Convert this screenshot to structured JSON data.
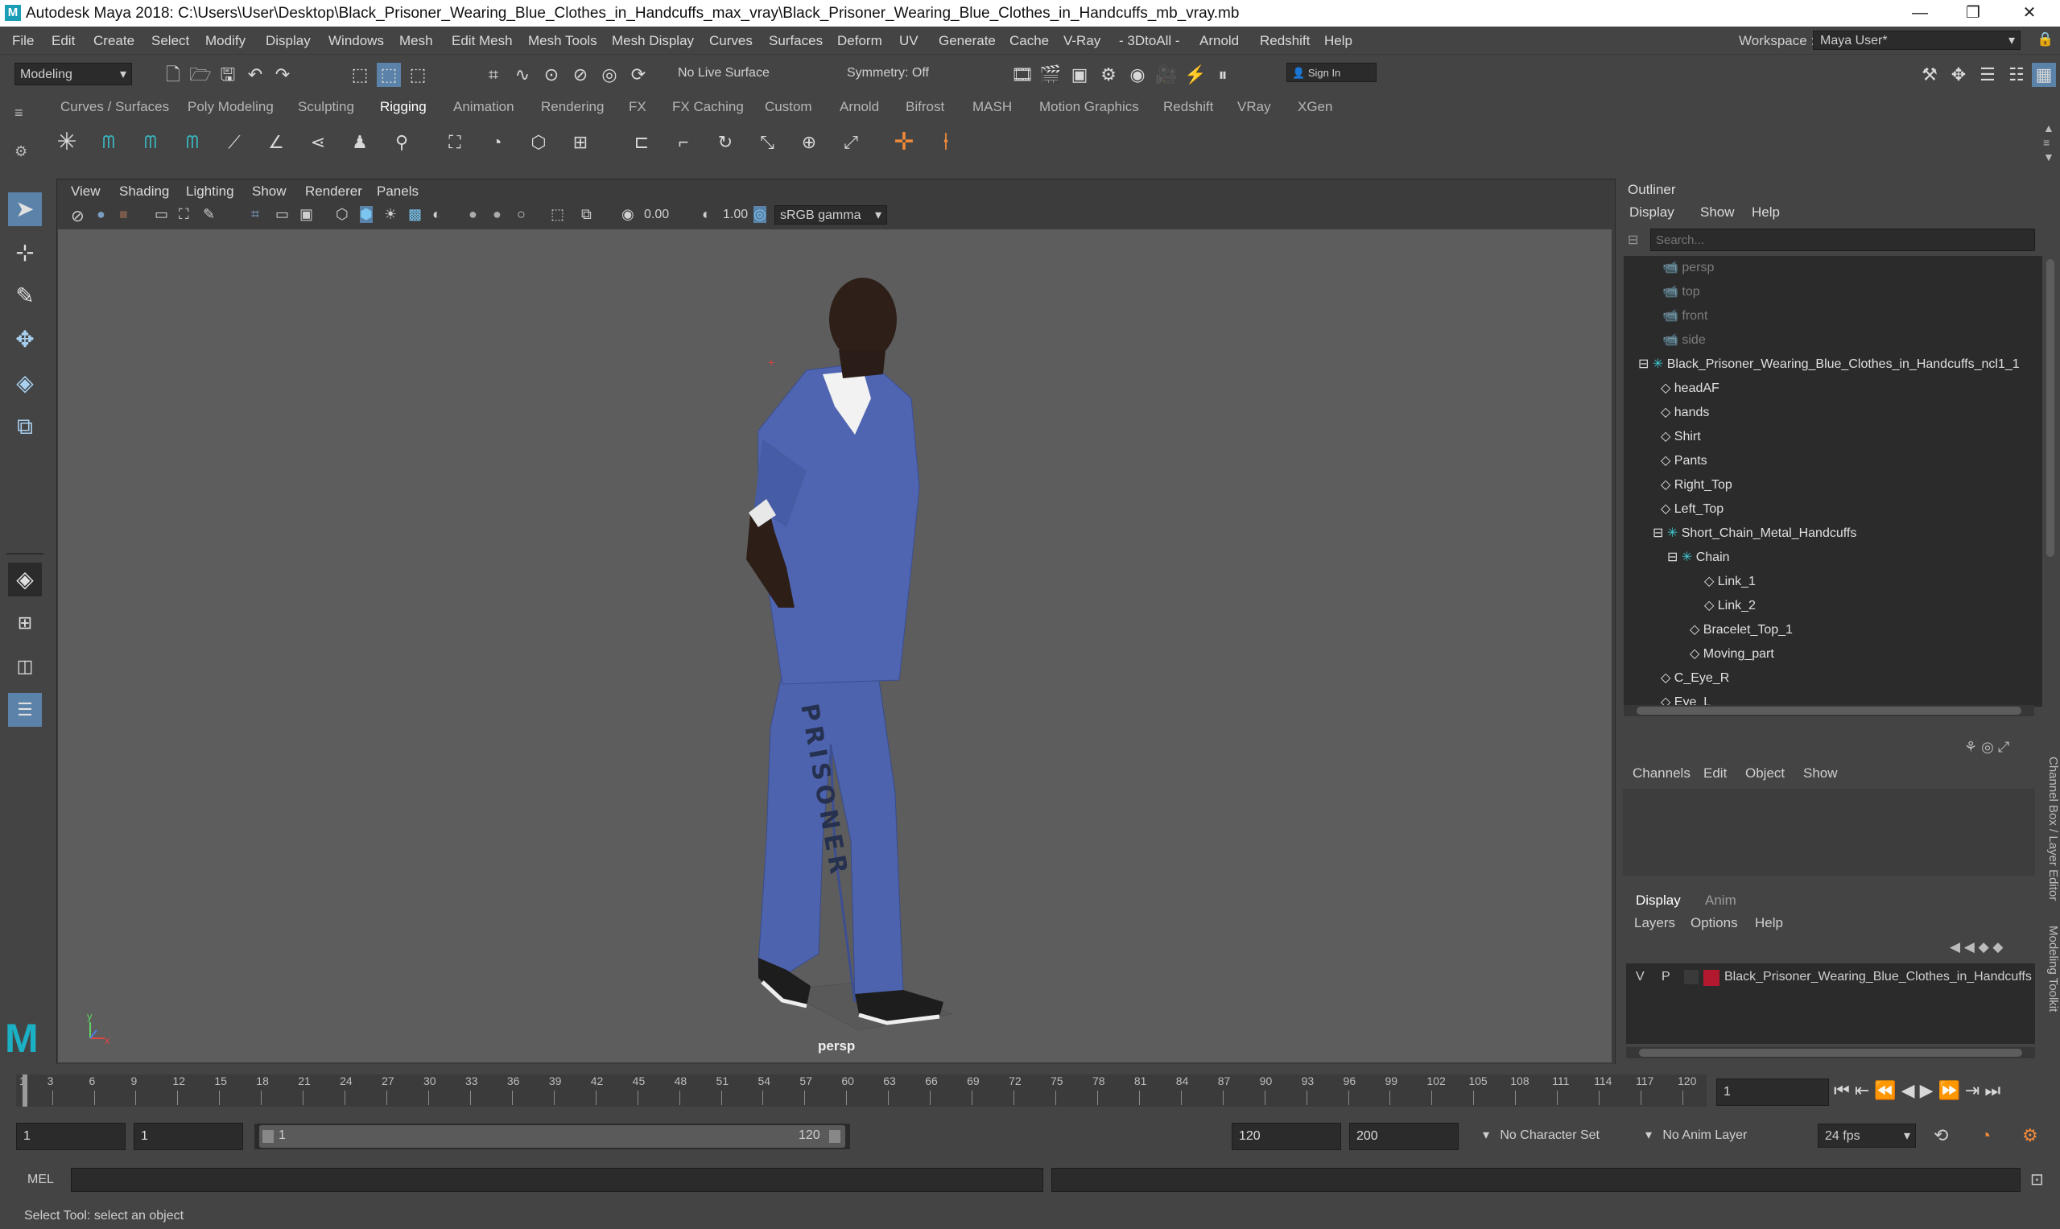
{
  "window": {
    "title": "Autodesk Maya 2018: C:\\Users\\User\\Desktop\\Black_Prisoner_Wearing_Blue_Clothes_in_Handcuffs_max_vray\\Black_Prisoner_Wearing_Blue_Clothes_in_Handcuffs_mb_vray.mb",
    "logo": "M",
    "controls": [
      "—",
      "❐",
      "✕"
    ]
  },
  "menubar": {
    "items": [
      "File",
      "Edit",
      "Create",
      "Select",
      "Modify",
      "Display",
      "Windows",
      "Mesh",
      "Edit Mesh",
      "Mesh Tools",
      "Mesh Display",
      "Curves",
      "Surfaces",
      "Deform",
      "UV",
      "Generate",
      "Cache",
      "V-Ray",
      "- 3DtoAll -",
      "Arnold",
      "Redshift",
      "Help"
    ],
    "workspace_label": "Workspace :",
    "workspace_value": "Maya User*"
  },
  "statusline": {
    "mode": "Modeling",
    "live_surface": "No Live Surface",
    "symmetry": "Symmetry: Off",
    "sign_in": "Sign In"
  },
  "shelf": {
    "tabs": [
      "Curves / Surfaces",
      "Poly Modeling",
      "Sculpting",
      "Rigging",
      "Animation",
      "Rendering",
      "FX",
      "FX Caching",
      "Custom",
      "Arnold",
      "Bifrost",
      "MASH",
      "Motion Graphics",
      "Redshift",
      "VRay",
      "XGen"
    ],
    "active_tab": "Rigging"
  },
  "viewport": {
    "menu": [
      "View",
      "Shading",
      "Lighting",
      "Show",
      "Renderer",
      "Panels"
    ],
    "exposure": "0.00",
    "gamma": "1.00",
    "color_space": "sRGB gamma",
    "camera_label": "persp",
    "leg_text": "PRISONER",
    "axis_y": "y",
    "axis_x": "x"
  },
  "outliner": {
    "title": "Outliner",
    "menu": [
      "Display",
      "Show",
      "Help"
    ],
    "search_placeholder": "Search...",
    "items": [
      {
        "label": "persp",
        "icon": "camera-icon",
        "indent": 0,
        "dim": true
      },
      {
        "label": "top",
        "icon": "camera-icon",
        "indent": 0,
        "dim": true
      },
      {
        "label": "front",
        "icon": "camera-icon",
        "indent": 0,
        "dim": true
      },
      {
        "label": "side",
        "icon": "camera-icon",
        "indent": 0,
        "dim": true
      },
      {
        "label": "Black_Prisoner_Wearing_Blue_Clothes_in_Handcuffs_ncl1_1",
        "icon": "group-icon",
        "indent": 0,
        "dim": false,
        "expanded": true
      },
      {
        "label": "headAF",
        "icon": "mesh-icon",
        "indent": 1,
        "dim": false
      },
      {
        "label": "hands",
        "icon": "mesh-icon",
        "indent": 1,
        "dim": false
      },
      {
        "label": "Shirt",
        "icon": "mesh-icon",
        "indent": 1,
        "dim": false
      },
      {
        "label": "Pants",
        "icon": "mesh-icon",
        "indent": 1,
        "dim": false
      },
      {
        "label": "Right_Top",
        "icon": "mesh-icon",
        "indent": 1,
        "dim": false
      },
      {
        "label": "Left_Top",
        "icon": "mesh-icon",
        "indent": 1,
        "dim": false
      },
      {
        "label": "Short_Chain_Metal_Handcuffs",
        "icon": "group-icon",
        "indent": 1,
        "dim": false,
        "expanded": true
      },
      {
        "label": "Chain",
        "icon": "group-icon",
        "indent": 2,
        "dim": false,
        "expanded": true
      },
      {
        "label": "Link_1",
        "icon": "mesh-icon",
        "indent": 3,
        "dim": false
      },
      {
        "label": "Link_2",
        "icon": "mesh-icon",
        "indent": 3,
        "dim": false
      },
      {
        "label": "Bracelet_Top_1",
        "icon": "mesh-icon",
        "indent": 2,
        "dim": false
      },
      {
        "label": "Moving_part",
        "icon": "mesh-icon",
        "indent": 2,
        "dim": false
      },
      {
        "label": "C_Eye_R",
        "icon": "mesh-icon",
        "indent": 1,
        "dim": false
      },
      {
        "label": "Eye_L",
        "icon": "mesh-icon",
        "indent": 1,
        "dim": false
      }
    ]
  },
  "channelbox": {
    "menu": [
      "Channels",
      "Edit",
      "Object",
      "Show"
    ],
    "side_tab": "Channel Box / Layer Editor",
    "side_tab2": "Modeling Toolkit"
  },
  "layers": {
    "tabs": [
      "Display",
      "Anim"
    ],
    "menu": [
      "Layers",
      "Options",
      "Help"
    ],
    "row": {
      "v": "V",
      "p": "P",
      "name": "Black_Prisoner_Wearing_Blue_Clothes_in_Handcuffs",
      "color": "#b3192e"
    }
  },
  "timeline": {
    "ticks": [
      "1",
      "3",
      "6",
      "9",
      "12",
      "15",
      "18",
      "21",
      "24",
      "27",
      "30",
      "33",
      "36",
      "39",
      "42",
      "45",
      "48",
      "51",
      "54",
      "57",
      "60",
      "63",
      "66",
      "69",
      "72",
      "75",
      "78",
      "81",
      "84",
      "87",
      "90",
      "93",
      "96",
      "99",
      "102",
      "105",
      "108",
      "111",
      "114",
      "117",
      "120"
    ],
    "current_frame": "1"
  },
  "range": {
    "start": "1",
    "anim_start": "1",
    "slider_start": "1",
    "slider_end": "120",
    "end": "120",
    "anim_end": "200",
    "character_set": "No Character Set",
    "anim_layer": "No Anim Layer",
    "fps": "24 fps"
  },
  "command": {
    "label": "MEL"
  },
  "help": {
    "text": "Select Tool: select an object"
  }
}
